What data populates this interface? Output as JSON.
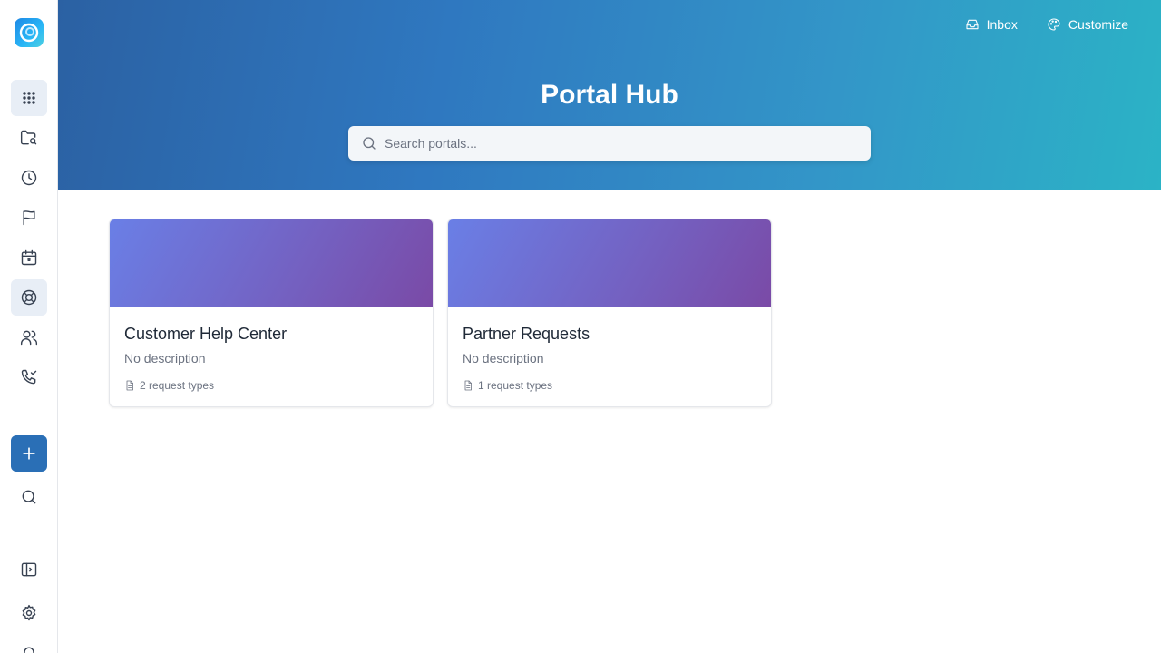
{
  "header": {
    "inbox_label": "Inbox",
    "customize_label": "Customize"
  },
  "hero": {
    "title": "Portal Hub",
    "search_placeholder": "Search portals...",
    "search_value": ""
  },
  "sidebar": {
    "items": [
      {
        "name": "apps-grid-icon",
        "active": true
      },
      {
        "name": "folder-search-icon",
        "active": false
      },
      {
        "name": "clock-icon",
        "active": false
      },
      {
        "name": "flag-icon",
        "active": false
      },
      {
        "name": "calendar-icon",
        "active": false
      },
      {
        "name": "lifebuoy-icon",
        "active": true
      },
      {
        "name": "users-icon",
        "active": false
      },
      {
        "name": "phone-check-icon",
        "active": false
      }
    ]
  },
  "portals": [
    {
      "title": "Customer Help Center",
      "description": "No description",
      "request_types": "2 request types"
    },
    {
      "title": "Partner Requests",
      "description": "No description",
      "request_types": "1 request types"
    }
  ],
  "colors": {
    "accent": "#2a6fb6",
    "hero_start": "#2b61a3",
    "hero_end": "#2bb3c6",
    "card_banner_start": "#6a7fe6",
    "card_banner_end": "#7a4aa6"
  }
}
